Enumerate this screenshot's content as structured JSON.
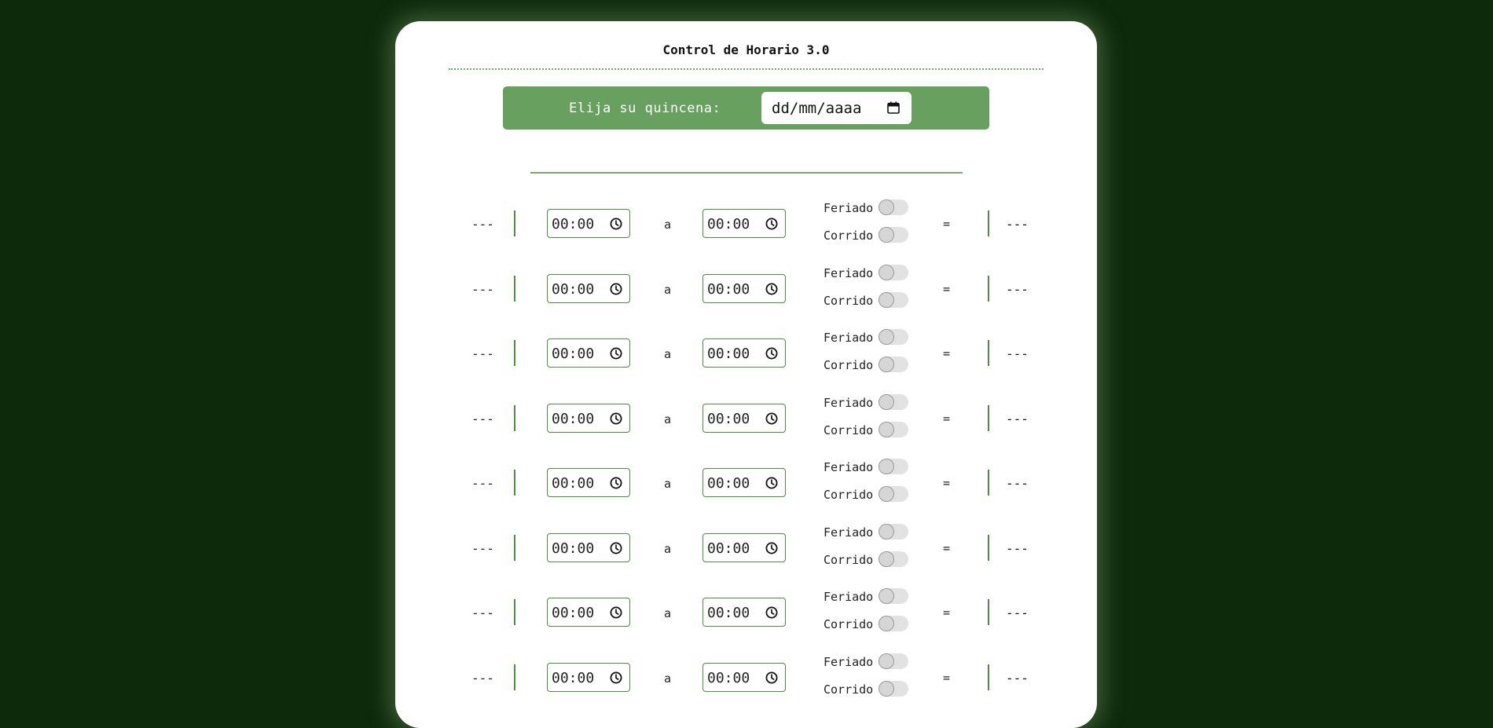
{
  "page": {
    "title": "Control de Horario 3.0"
  },
  "picker": {
    "label": "Elija su quincena:",
    "date_placeholder": "dd/mm/aaaa",
    "icon": "calendar-icon"
  },
  "labels": {
    "to": "a",
    "equals": "=",
    "holiday": "Feriado",
    "continuous": "Corrido"
  },
  "rows": [
    {
      "day": "---",
      "from": "00:00",
      "to": "00:00",
      "feriado": false,
      "corrido": false,
      "total": "---"
    },
    {
      "day": "---",
      "from": "00:00",
      "to": "00:00",
      "feriado": false,
      "corrido": false,
      "total": "---"
    },
    {
      "day": "---",
      "from": "00:00",
      "to": "00:00",
      "feriado": false,
      "corrido": false,
      "total": "---"
    },
    {
      "day": "---",
      "from": "00:00",
      "to": "00:00",
      "feriado": false,
      "corrido": false,
      "total": "---"
    },
    {
      "day": "---",
      "from": "00:00",
      "to": "00:00",
      "feriado": false,
      "corrido": false,
      "total": "---"
    },
    {
      "day": "---",
      "from": "00:00",
      "to": "00:00",
      "feriado": false,
      "corrido": false,
      "total": "---"
    },
    {
      "day": "---",
      "from": "00:00",
      "to": "00:00",
      "feriado": false,
      "corrido": false,
      "total": "---"
    },
    {
      "day": "---",
      "from": "00:00",
      "to": "00:00",
      "feriado": false,
      "corrido": false,
      "total": "---"
    }
  ],
  "colors": {
    "background": "#0d2a0b",
    "accent": "#68a060",
    "border": "#4f8a46"
  }
}
